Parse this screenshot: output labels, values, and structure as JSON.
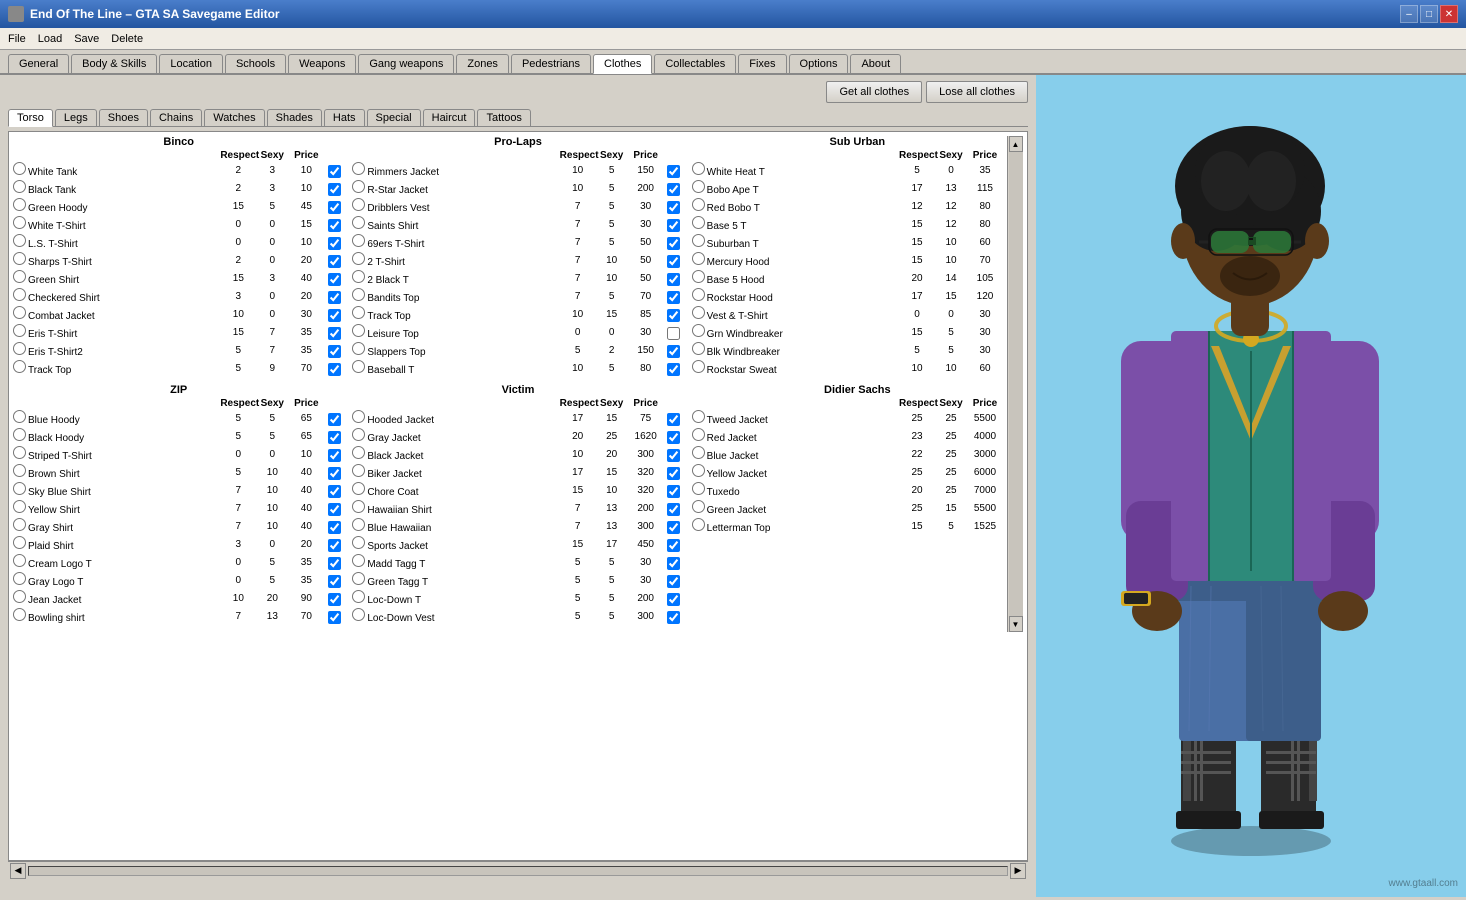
{
  "window": {
    "title": "End Of The Line – GTA SA Savegame Editor",
    "icon": "game-icon"
  },
  "titleControls": [
    "minimize",
    "maximize",
    "close"
  ],
  "menuBar": [
    "File",
    "Load",
    "Save",
    "Delete"
  ],
  "mainTabs": [
    "General",
    "Body & Skills",
    "Location",
    "Schools",
    "Weapons",
    "Gang weapons",
    "Zones",
    "Pedestrians",
    "Clothes",
    "Collectables",
    "Fixes",
    "Options",
    "About"
  ],
  "activeMainTab": "Clothes",
  "buttons": {
    "getAllClothes": "Get all clothes",
    "loseAllClothes": "Lose all clothes"
  },
  "subTabs": [
    "Torso",
    "Legs",
    "Shoes",
    "Chains",
    "Watches",
    "Shades",
    "Hats",
    "Special",
    "Haircut",
    "Tattoos"
  ],
  "activeSubTab": "Torso",
  "columns": [
    "Respect",
    "Sexy",
    "Price"
  ],
  "sections": {
    "binco": {
      "name": "Binco",
      "items": [
        {
          "name": "White Tank",
          "r": 2,
          "s": 3,
          "p": 10,
          "checked": true,
          "radio": false
        },
        {
          "name": "Black Tank",
          "r": 2,
          "s": 3,
          "p": 10,
          "checked": true,
          "radio": false
        },
        {
          "name": "Green Hoody",
          "r": 15,
          "s": 5,
          "p": 45,
          "checked": true,
          "radio": false
        },
        {
          "name": "White T-Shirt",
          "r": 0,
          "s": 0,
          "p": 15,
          "checked": true,
          "radio": false
        },
        {
          "name": "L.S. T-Shirt",
          "r": 0,
          "s": 0,
          "p": 10,
          "checked": true,
          "radio": false
        },
        {
          "name": "Sharps T-Shirt",
          "r": 2,
          "s": 0,
          "p": 20,
          "checked": true,
          "radio": false
        },
        {
          "name": "Green Shirt",
          "r": 15,
          "s": 3,
          "p": 40,
          "checked": true,
          "radio": false
        },
        {
          "name": "Checkered Shirt",
          "r": 3,
          "s": 0,
          "p": 20,
          "checked": true,
          "radio": false
        },
        {
          "name": "Combat Jacket",
          "r": 10,
          "s": 0,
          "p": 30,
          "checked": true,
          "radio": false
        },
        {
          "name": "Eris T-Shirt",
          "r": 15,
          "s": 7,
          "p": 35,
          "checked": true,
          "radio": false
        },
        {
          "name": "Eris T-Shirt2",
          "r": 5,
          "s": 7,
          "p": 35,
          "checked": true,
          "radio": false
        },
        {
          "name": "Track Top",
          "r": 5,
          "s": 9,
          "p": 70,
          "checked": true,
          "radio": false
        }
      ]
    },
    "prolaps": {
      "name": "Pro-Laps",
      "items": [
        {
          "name": "Rimmers Jacket",
          "r": 10,
          "s": 5,
          "p": 150,
          "checked": true,
          "radio": false
        },
        {
          "name": "R-Star Jacket",
          "r": 10,
          "s": 5,
          "p": 200,
          "checked": true,
          "radio": false
        },
        {
          "name": "Dribblers Vest",
          "r": 7,
          "s": 5,
          "p": 30,
          "checked": true,
          "radio": false
        },
        {
          "name": "Saints Shirt",
          "r": 7,
          "s": 5,
          "p": 30,
          "checked": true,
          "radio": false
        },
        {
          "name": "69ers T-Shirt",
          "r": 7,
          "s": 5,
          "p": 50,
          "checked": true,
          "radio": false
        },
        {
          "name": "2 T-Shirt",
          "r": 7,
          "s": 10,
          "p": 50,
          "checked": true,
          "radio": false
        },
        {
          "name": "2 Black T",
          "r": 7,
          "s": 10,
          "p": 50,
          "checked": true,
          "radio": false
        },
        {
          "name": "Bandits Top",
          "r": 7,
          "s": 5,
          "p": 70,
          "checked": true,
          "radio": false
        },
        {
          "name": "Track Top",
          "r": 10,
          "s": 15,
          "p": 85,
          "checked": true,
          "radio": false
        },
        {
          "name": "Leisure Top",
          "r": 0,
          "s": 0,
          "p": 30,
          "checked": false,
          "radio": true
        },
        {
          "name": "Slappers Top",
          "r": 5,
          "s": 2,
          "p": 150,
          "checked": true,
          "radio": false
        },
        {
          "name": "Baseball T",
          "r": 10,
          "s": 5,
          "p": 80,
          "checked": true,
          "radio": false
        }
      ]
    },
    "suburbanTorso": {
      "name": "Sub Urban",
      "items": [
        {
          "name": "White Heat T",
          "r": 5,
          "s": 0,
          "p": 35,
          "checked": false,
          "radio": false
        },
        {
          "name": "Bobo Ape T",
          "r": 17,
          "s": 13,
          "p": 115,
          "checked": false,
          "radio": false
        },
        {
          "name": "Red Bobo T",
          "r": 12,
          "s": 12,
          "p": 80,
          "checked": false,
          "radio": false
        },
        {
          "name": "Base 5 T",
          "r": 15,
          "s": 12,
          "p": 80,
          "checked": false,
          "radio": false
        },
        {
          "name": "Suburban T",
          "r": 15,
          "s": 10,
          "p": 60,
          "checked": false,
          "radio": false
        },
        {
          "name": "Mercury Hood",
          "r": 15,
          "s": 10,
          "p": 70,
          "checked": false,
          "radio": false
        },
        {
          "name": "Base 5 Hood",
          "r": 20,
          "s": 14,
          "p": 105,
          "checked": false,
          "radio": false
        },
        {
          "name": "Rockstar Hood",
          "r": 17,
          "s": 15,
          "p": 120,
          "checked": false,
          "radio": false
        },
        {
          "name": "Vest & T-Shirt",
          "r": 0,
          "s": 0,
          "p": 30,
          "checked": false,
          "radio": true
        },
        {
          "name": "Grn Windbreaker",
          "r": 15,
          "s": 5,
          "p": 30,
          "checked": false,
          "radio": false
        },
        {
          "name": "Blk Windbreaker",
          "r": 5,
          "s": 5,
          "p": 30,
          "checked": false,
          "radio": false
        },
        {
          "name": "Rockstar Sweat",
          "r": 10,
          "s": 10,
          "p": 60,
          "checked": false,
          "radio": false
        }
      ]
    },
    "zip": {
      "name": "ZIP",
      "items": [
        {
          "name": "Blue Hoody",
          "r": 5,
          "s": 5,
          "p": 65,
          "checked": true,
          "radio": false
        },
        {
          "name": "Black Hoody",
          "r": 5,
          "s": 5,
          "p": 65,
          "checked": true,
          "radio": false
        },
        {
          "name": "Striped T-Shirt",
          "r": 0,
          "s": 0,
          "p": 10,
          "checked": true,
          "radio": false
        },
        {
          "name": "Brown Shirt",
          "r": 5,
          "s": 10,
          "p": 40,
          "checked": true,
          "radio": false
        },
        {
          "name": "Sky Blue Shirt",
          "r": 7,
          "s": 10,
          "p": 40,
          "checked": true,
          "radio": false
        },
        {
          "name": "Yellow Shirt",
          "r": 7,
          "s": 10,
          "p": 40,
          "checked": true,
          "radio": false
        },
        {
          "name": "Gray Shirt",
          "r": 7,
          "s": 10,
          "p": 40,
          "checked": true,
          "radio": false
        },
        {
          "name": "Plaid Shirt",
          "r": 3,
          "s": 0,
          "p": 20,
          "checked": true,
          "radio": false
        },
        {
          "name": "Cream Logo T",
          "r": 0,
          "s": 5,
          "p": 35,
          "checked": true,
          "radio": false
        },
        {
          "name": "Gray Logo T",
          "r": 0,
          "s": 5,
          "p": 35,
          "checked": true,
          "radio": false
        },
        {
          "name": "Jean Jacket",
          "r": 10,
          "s": 20,
          "p": 90,
          "checked": true,
          "radio": false
        },
        {
          "name": "Bowling shirt",
          "r": 7,
          "s": 13,
          "p": 70,
          "checked": true,
          "radio": false
        }
      ]
    },
    "victim": {
      "name": "Victim",
      "items": [
        {
          "name": "Hooded Jacket",
          "r": 17,
          "s": 15,
          "p": 75,
          "checked": true,
          "radio": false
        },
        {
          "name": "Gray Jacket",
          "r": 20,
          "s": 25,
          "p": 1620,
          "checked": true,
          "radio": false
        },
        {
          "name": "Black Jacket",
          "r": 10,
          "s": 20,
          "p": 300,
          "checked": true,
          "radio": false
        },
        {
          "name": "Biker Jacket",
          "r": 17,
          "s": 15,
          "p": 320,
          "checked": true,
          "radio": false
        },
        {
          "name": "Chore Coat",
          "r": 15,
          "s": 10,
          "p": 320,
          "checked": true,
          "radio": false
        },
        {
          "name": "Hawaiian Shirt",
          "r": 7,
          "s": 13,
          "p": 200,
          "checked": true,
          "radio": false
        },
        {
          "name": "Blue Hawaiian",
          "r": 7,
          "s": 13,
          "p": 300,
          "checked": true,
          "radio": false
        },
        {
          "name": "Sports Jacket",
          "r": 15,
          "s": 17,
          "p": 450,
          "checked": true,
          "radio": false
        },
        {
          "name": "Madd Tagg T",
          "r": 5,
          "s": 5,
          "p": 30,
          "checked": true,
          "radio": false
        },
        {
          "name": "Green Tagg T",
          "r": 5,
          "s": 5,
          "p": 30,
          "checked": true,
          "radio": false
        },
        {
          "name": "Loc-Down T",
          "r": 5,
          "s": 5,
          "p": 200,
          "checked": true,
          "radio": false
        },
        {
          "name": "Loc-Down Vest",
          "r": 5,
          "s": 5,
          "p": 300,
          "checked": true,
          "radio": false
        }
      ]
    },
    "didierSachs": {
      "name": "Didier Sachs",
      "items": [
        {
          "name": "Tweed Jacket",
          "r": 25,
          "s": 25,
          "p": 5500,
          "checked": false,
          "radio": false
        },
        {
          "name": "Red Jacket",
          "r": 23,
          "s": 25,
          "p": 4000,
          "checked": false,
          "radio": false
        },
        {
          "name": "Blue Jacket",
          "r": 22,
          "s": 25,
          "p": 3000,
          "checked": false,
          "radio": false
        },
        {
          "name": "Yellow Jacket",
          "r": 25,
          "s": 25,
          "p": 6000,
          "checked": false,
          "radio": false
        },
        {
          "name": "Tuxedo",
          "r": 20,
          "s": 25,
          "p": 7000,
          "checked": false,
          "radio": false
        },
        {
          "name": "Green Jacket",
          "r": 25,
          "s": 15,
          "p": 5500,
          "checked": false,
          "radio": false
        },
        {
          "name": "Letterman Top",
          "r": 15,
          "s": 5,
          "p": 1525,
          "checked": false,
          "radio": false
        }
      ]
    }
  }
}
